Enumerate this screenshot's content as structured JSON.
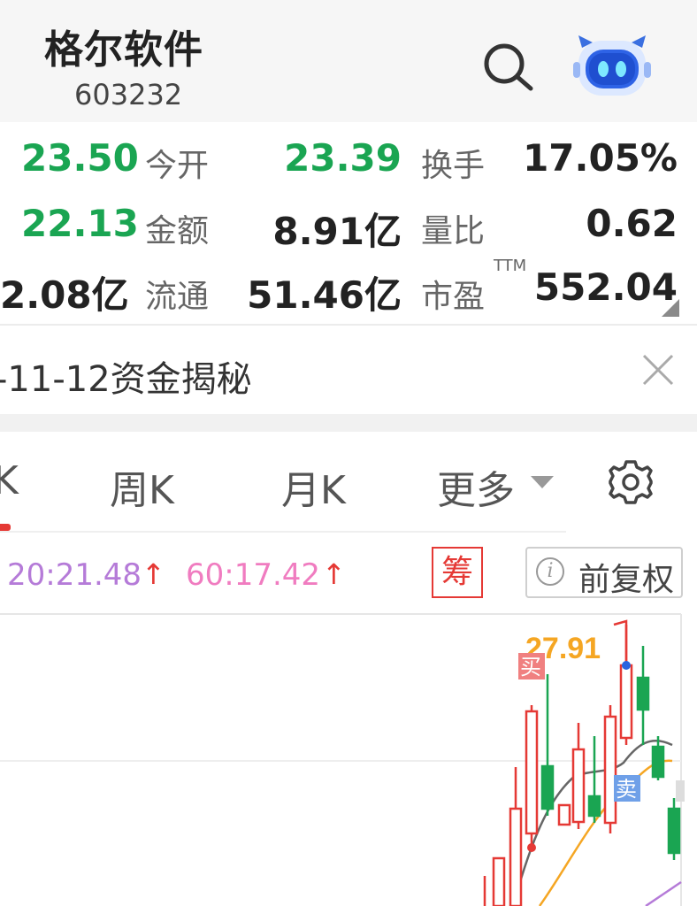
{
  "header": {
    "title": "格尔软件",
    "code": "603232"
  },
  "stats": {
    "row1": {
      "v1": "23.50",
      "l2": "今开",
      "v2": "23.39",
      "l3": "换手",
      "v3": "17.05%"
    },
    "row2": {
      "v1": "22.13",
      "l2": "金额",
      "v2": "8.91亿",
      "l3": "量比",
      "v3": "0.62"
    },
    "row3": {
      "v1": "2.08亿",
      "l2": "流通",
      "v2": "51.46亿",
      "l3": "市盈",
      "l3_sup": "TTM",
      "v3": "552.04"
    }
  },
  "news": {
    "text": "-11-12资金揭秘"
  },
  "tabs": {
    "t0": "K",
    "t1": "周K",
    "t2": "月K",
    "t3": "更多"
  },
  "indicators": {
    "ma20": "20:21.48",
    "ma60": "60:17.42",
    "arrow": "↑",
    "chouma": "筹",
    "fuquan": "前复权",
    "info_glyph": "i"
  },
  "chart_labels": {
    "high": "27.91",
    "buy": "买",
    "sell": "卖"
  },
  "colors": {
    "up": "#e53935",
    "down": "#1aa552",
    "ma20": "#b57bd8",
    "ma60": "#f07cc0",
    "high_label": "#f5a623"
  }
}
